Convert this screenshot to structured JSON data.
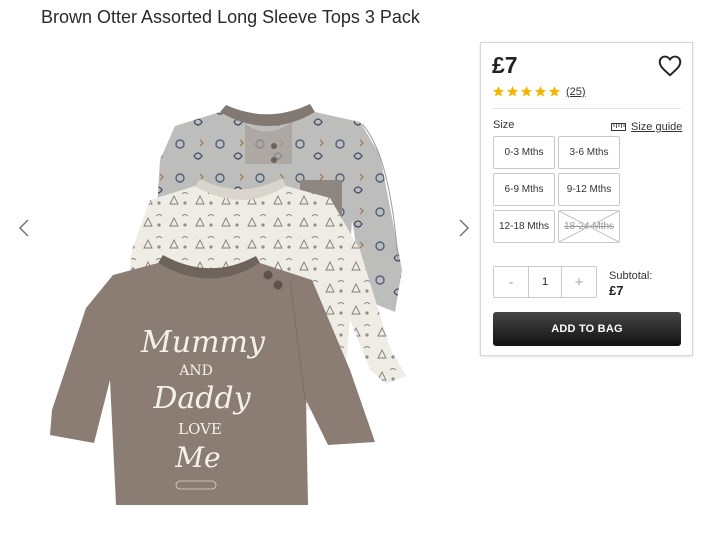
{
  "product": {
    "title": "Brown Otter Assorted Long Sleeve Tops 3 Pack",
    "image_alt": "Three baby long sleeve tops: grey otter print, cream woodland print, brown Mummy and Daddy love me",
    "print_text": [
      "Mummy",
      "AND",
      "Daddy",
      "LOVE",
      "Me"
    ]
  },
  "gallery": {
    "prev_icon": "chevron-left-icon",
    "next_icon": "chevron-right-icon"
  },
  "purchase": {
    "price": "£7",
    "wishlist_icon": "heart-outline-icon",
    "rating": 5,
    "rating_max": 5,
    "review_count": "(25)",
    "size_label": "Size",
    "size_guide_label": "Size guide",
    "size_guide_icon": "ruler-icon",
    "sizes": [
      {
        "label": "0-3 Mths",
        "available": true
      },
      {
        "label": "3-6 Mths",
        "available": true
      },
      {
        "label": "6-9 Mths",
        "available": true
      },
      {
        "label": "9-12 Mths",
        "available": true
      },
      {
        "label": "12-18 Mths",
        "available": true
      },
      {
        "label": "18-24 Mths",
        "available": false
      }
    ],
    "quantity": {
      "minus": "-",
      "value": "1",
      "plus": "+"
    },
    "subtotal_label": "Subtotal:",
    "subtotal_value": "£7",
    "add_to_bag_label": "ADD TO BAG"
  },
  "colors": {
    "star": "#f5b400",
    "button_dark": "#1a1a1a",
    "panel_border": "#d6d6d6",
    "shirt_brown": "#8a7b70",
    "shirt_grey": "#b9b9b7",
    "shirt_cream": "#efece4"
  }
}
